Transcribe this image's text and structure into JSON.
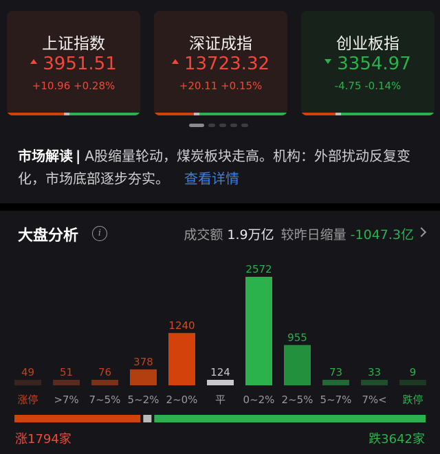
{
  "indices": [
    {
      "name": "上证指数",
      "value": "3951.51",
      "change": "+10.96 +0.28%",
      "direction": "up",
      "color": "#f0493b",
      "bar_up_fraction": 0.45
    },
    {
      "name": "深证成指",
      "value": "13723.32",
      "change": "+20.11 +0.15%",
      "direction": "up",
      "color": "#f0493b",
      "bar_up_fraction": 0.32
    },
    {
      "name": "创业板指",
      "value": "3354.97",
      "change": "-4.75 -0.14%",
      "direction": "down",
      "color": "#2bb24c",
      "bar_up_fraction": 0.28
    }
  ],
  "carousel": {
    "pages": 5,
    "active": 0
  },
  "market_reading": {
    "title": "市场解读",
    "separator": "|",
    "text": "A股缩量轮动，煤炭板块走高。机构：外部扰动反复变化，市场底部逐步夯实。",
    "link": "查看详情"
  },
  "analysis": {
    "title": "大盘分析",
    "info_icon": "info-icon",
    "turnover_label": "成交额",
    "turnover_value": "1.9万亿",
    "compare_label": "较昨日缩量",
    "compare_value": "-1047.3亿"
  },
  "chart_data": {
    "type": "bar",
    "categories": [
      "涨停",
      ">7%",
      "7~5%",
      "5~2%",
      "2~0%",
      "平",
      "0~2%",
      "2~5%",
      "5~7%",
      "7%<",
      "跌停"
    ],
    "values": [
      49,
      51,
      76,
      378,
      1240,
      124,
      2572,
      955,
      73,
      33,
      9
    ],
    "colors": [
      "#3a2420",
      "#5a2a1c",
      "#7a3114",
      "#b33f10",
      "#d4420c",
      "#c8c8cc",
      "#2bb24c",
      "#23903d",
      "#1f6b33",
      "#1d4f2a",
      "#1a3a22"
    ],
    "label_colors": [
      "#c0421e",
      "#c0421e",
      "#c0421e",
      "#c0421e",
      "#d84a1a",
      "#c8c8cc",
      "#2bb24c",
      "#2bb24c",
      "#2bb24c",
      "#2bb24c",
      "#2bb24c"
    ],
    "tick_colors": [
      "#c0421e",
      "#9a9a9a",
      "#9a9a9a",
      "#9a9a9a",
      "#9a9a9a",
      "#9a9a9a",
      "#9a9a9a",
      "#9a9a9a",
      "#9a9a9a",
      "#9a9a9a",
      "#2bb24c"
    ],
    "ylim": [
      0,
      2572
    ]
  },
  "breadth": {
    "up_label": "涨1794家",
    "down_label": "跌3642家",
    "up_count": 1794,
    "down_count": 3642
  }
}
